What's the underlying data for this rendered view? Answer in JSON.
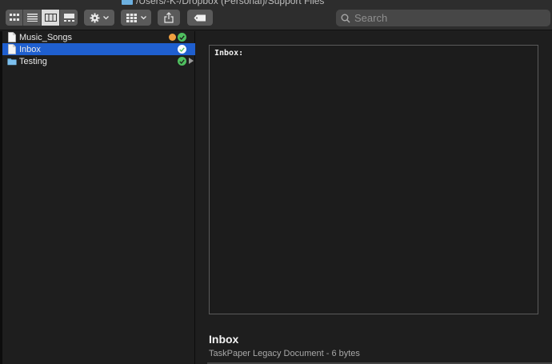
{
  "window": {
    "title": "/Users/-K-/Dropbox (Personal)/Support Files"
  },
  "toolbar": {
    "view_modes": [
      "icon-view",
      "list-view",
      "column-view",
      "gallery-view"
    ],
    "active_view": "column-view",
    "action_menu": "gear-icon",
    "group_menu": "group-icon",
    "share": "share-icon",
    "tags": "tag-icon"
  },
  "search": {
    "placeholder": "Search"
  },
  "files": [
    {
      "name": "Music_Songs",
      "type": "document",
      "status": "orange",
      "synced": true,
      "selected": false,
      "folder": false
    },
    {
      "name": "Inbox",
      "type": "document",
      "synced": true,
      "selected": true,
      "folder": false
    },
    {
      "name": "Testing",
      "type": "folder",
      "synced": true,
      "selected": false,
      "folder": true
    }
  ],
  "preview": {
    "content": "Inbox:",
    "file_name": "Inbox",
    "file_kind": "TaskPaper Legacy Document - 6 bytes"
  },
  "colors": {
    "selection": "#1f5fcf",
    "sync_ok": "#4fbf5f",
    "status_orange": "#f0a040",
    "folder": "#6cb0e0"
  }
}
